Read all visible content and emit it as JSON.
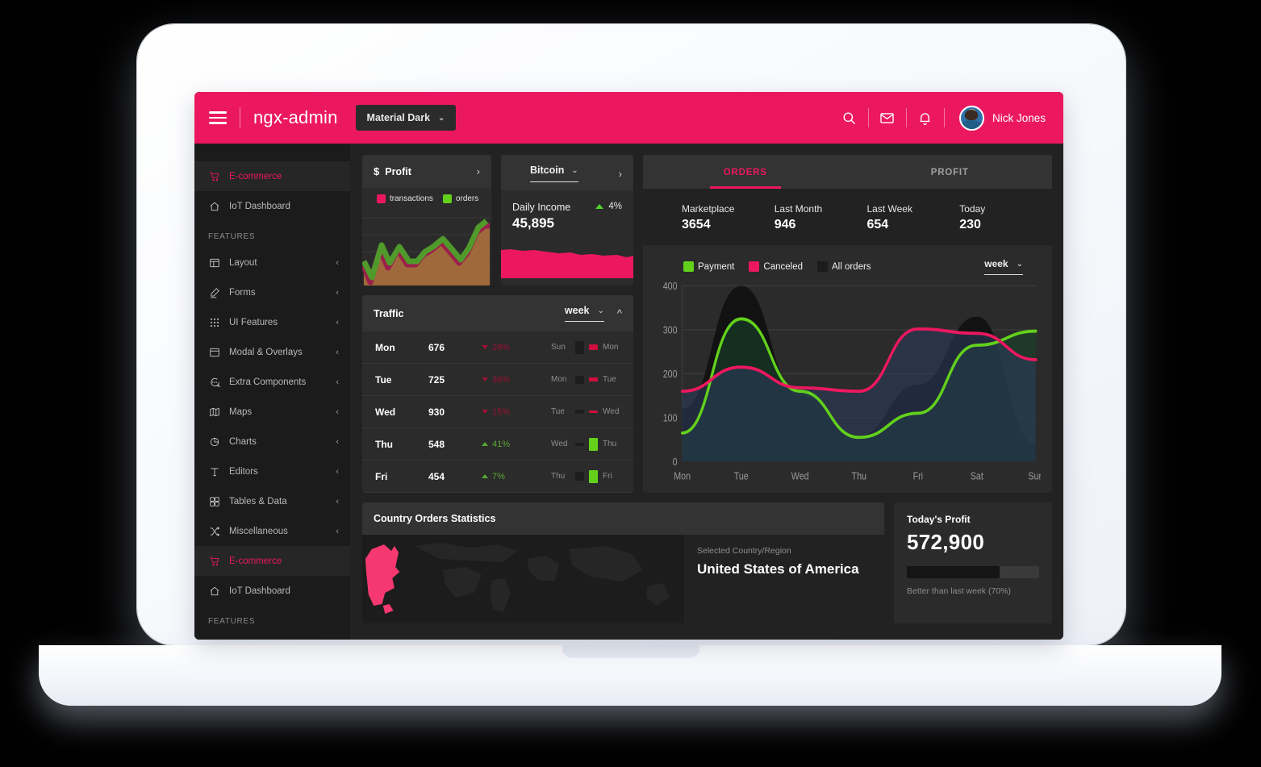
{
  "colors": {
    "brand_pink": "#ec185f",
    "green": "#63d11c",
    "dark_bg": "#222222",
    "card_bg": "#2b2b2b",
    "card_head_bg": "#333333",
    "sidebar_bg": "#1b1b1b"
  },
  "header": {
    "menu_icon": "hamburger-icon",
    "brand": "ngx-admin",
    "theme": {
      "label": "Material Dark",
      "caret": "⌄"
    },
    "icons": [
      "search-icon",
      "email-icon",
      "bell-icon"
    ],
    "user": {
      "name": "Nick Jones",
      "avatar": "user-avatar"
    }
  },
  "sidebar": {
    "items": [
      {
        "label": "E-commerce",
        "icon": "cart-icon",
        "active": true,
        "expandable": false
      },
      {
        "label": "IoT Dashboard",
        "icon": "home-icon",
        "active": false,
        "expandable": false
      },
      {
        "section": "FEATURES"
      },
      {
        "label": "Layout",
        "icon": "layout-icon",
        "active": false,
        "expandable": true
      },
      {
        "label": "Forms",
        "icon": "pencil-icon",
        "active": false,
        "expandable": true
      },
      {
        "label": "UI Features",
        "icon": "grid-dots-icon",
        "active": false,
        "expandable": true
      },
      {
        "label": "Modal & Overlays",
        "icon": "window-icon",
        "active": false,
        "expandable": true
      },
      {
        "label": "Extra Components",
        "icon": "chat-icon",
        "active": false,
        "expandable": true
      },
      {
        "label": "Maps",
        "icon": "map-icon",
        "active": false,
        "expandable": true
      },
      {
        "label": "Charts",
        "icon": "pie-chart-icon",
        "active": false,
        "expandable": true
      },
      {
        "label": "Editors",
        "icon": "text-icon",
        "active": false,
        "expandable": true
      },
      {
        "label": "Tables & Data",
        "icon": "table-icon",
        "active": false,
        "expandable": true
      },
      {
        "label": "Miscellaneous",
        "icon": "shuffle-icon",
        "active": false,
        "expandable": true
      },
      {
        "label": "E-commerce",
        "icon": "cart-icon",
        "active": true,
        "expandable": false
      },
      {
        "label": "IoT Dashboard",
        "icon": "home-icon",
        "active": false,
        "expandable": false
      },
      {
        "section": "FEATURES"
      }
    ],
    "chevron": "‹"
  },
  "profit_card": {
    "currency_icon": "dollar-icon",
    "title": "Profit",
    "arrow": "›",
    "legend": [
      {
        "label": "transactions",
        "color": "#ec185f"
      },
      {
        "label": "orders",
        "color": "#63d11c"
      }
    ]
  },
  "bitcoin_card": {
    "selected": "Bitcoin",
    "caret": "⌄",
    "arrow": "›",
    "income_label": "Daily Income",
    "delta": "4%",
    "delta_direction": "up",
    "value": "45,895"
  },
  "traffic_card": {
    "title": "Traffic",
    "period": "week",
    "caret": "⌄",
    "collapse_icon": "chevron-up-icon",
    "rows": [
      {
        "day": "Mon",
        "value": "676",
        "delta": "28%",
        "dir": "down",
        "prev": "Sun",
        "next": "Mon",
        "a": 16,
        "b": 7,
        "bcolor": "#cf0f3e"
      },
      {
        "day": "Tue",
        "value": "725",
        "delta": "36%",
        "dir": "down",
        "prev": "Mon",
        "next": "Tue",
        "a": 10,
        "b": 5,
        "bcolor": "#cf0f3e"
      },
      {
        "day": "Wed",
        "value": "930",
        "delta": "15%",
        "dir": "down",
        "prev": "Tue",
        "next": "Wed",
        "a": 5,
        "b": 3,
        "bcolor": "#cf0f3e"
      },
      {
        "day": "Thu",
        "value": "548",
        "delta": "41%",
        "dir": "up",
        "prev": "Wed",
        "next": "Thu",
        "a": 4,
        "b": 16,
        "bcolor": "#63d11c"
      },
      {
        "day": "Fri",
        "value": "454",
        "delta": "7%",
        "dir": "up",
        "prev": "Thu",
        "next": "Fri",
        "a": 11,
        "b": 16,
        "bcolor": "#63d11c"
      }
    ]
  },
  "orders_card": {
    "tabs": [
      {
        "label": "ORDERS",
        "active": true
      },
      {
        "label": "PROFIT",
        "active": false
      }
    ],
    "stats": [
      {
        "label": "Marketplace",
        "value": "3654"
      },
      {
        "label": "Last Month",
        "value": "946"
      },
      {
        "label": "Last Week",
        "value": "654"
      },
      {
        "label": "Today",
        "value": "230"
      }
    ],
    "legend": [
      {
        "label": "Payment",
        "color": "#63d11c"
      },
      {
        "label": "Canceled",
        "color": "#ec185f"
      },
      {
        "label": "All orders",
        "color": "#1b1b1b"
      }
    ],
    "period": "week",
    "caret": "⌄"
  },
  "chart_data": {
    "type": "area",
    "title": "Orders",
    "xlabel": "",
    "ylabel": "",
    "grid": true,
    "legend_position": "top-left",
    "categories": [
      "Mon",
      "Tue",
      "Wed",
      "Thu",
      "Fri",
      "Sat",
      "Sun"
    ],
    "x_tick_labels": [
      "Mon",
      "Tue",
      "Wed",
      "Thu",
      "Fri",
      "Sat",
      "Sun"
    ],
    "y_tick_labels": [
      "0",
      "100",
      "200",
      "300",
      "400"
    ],
    "ylim": [
      0,
      400
    ],
    "series": [
      {
        "name": "All orders",
        "color": "#1b1b1b",
        "values": [
          120,
          400,
          150,
          60,
          175,
          330,
          40
        ]
      },
      {
        "name": "Payment",
        "color": "#63d11c",
        "values": [
          65,
          325,
          160,
          55,
          110,
          265,
          297
        ]
      },
      {
        "name": "Canceled",
        "color": "#ec185f",
        "values": [
          160,
          215,
          168,
          160,
          302,
          292,
          232
        ]
      }
    ]
  },
  "country_card": {
    "title": "Country Orders Statistics",
    "selected_label": "Selected Country/Region",
    "country": "United States of America",
    "highlight_color": "#f5386f"
  },
  "today_profit": {
    "label": "Today's Profit",
    "value": "572,900",
    "progress": 70,
    "note": "Better than last week (70%)"
  }
}
